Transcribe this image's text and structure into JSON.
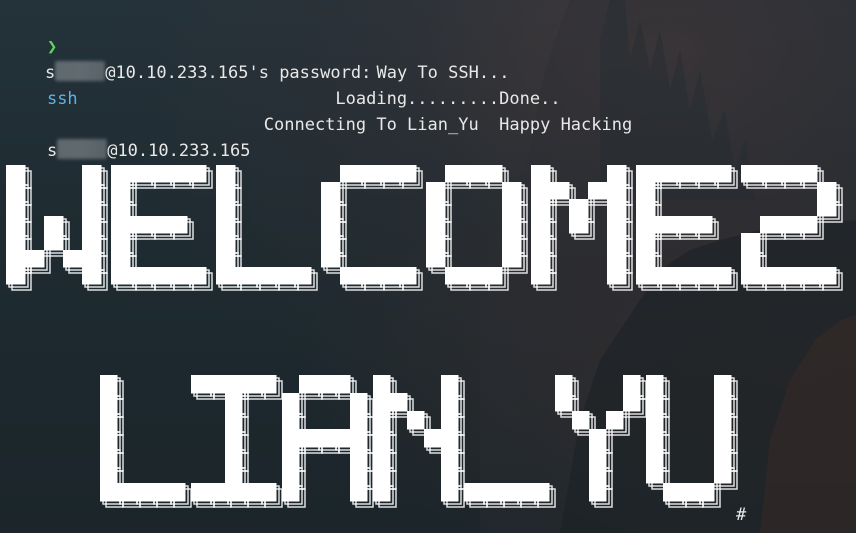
{
  "terminal": {
    "prompt_symbol": "❯",
    "command": "ssh",
    "user_prefix": "s",
    "host": "@10.10.233.165",
    "password_host": "@10.10.233.165's password:",
    "password_prefix": "s",
    "banner_lines": [
      "Way To SSH...",
      "Loading.........Done..",
      "Connecting To Lian_Yu  Happy Hacking"
    ],
    "ascii_art": {
      "line1": "WELCOME2",
      "line2": "LIAN_YU"
    },
    "cursor_prompt": "#"
  },
  "colors": {
    "background": "#1f2a2f",
    "text": "#e8e8e8",
    "prompt_arrow": "#5fd35f",
    "command": "#5eb3e6"
  }
}
